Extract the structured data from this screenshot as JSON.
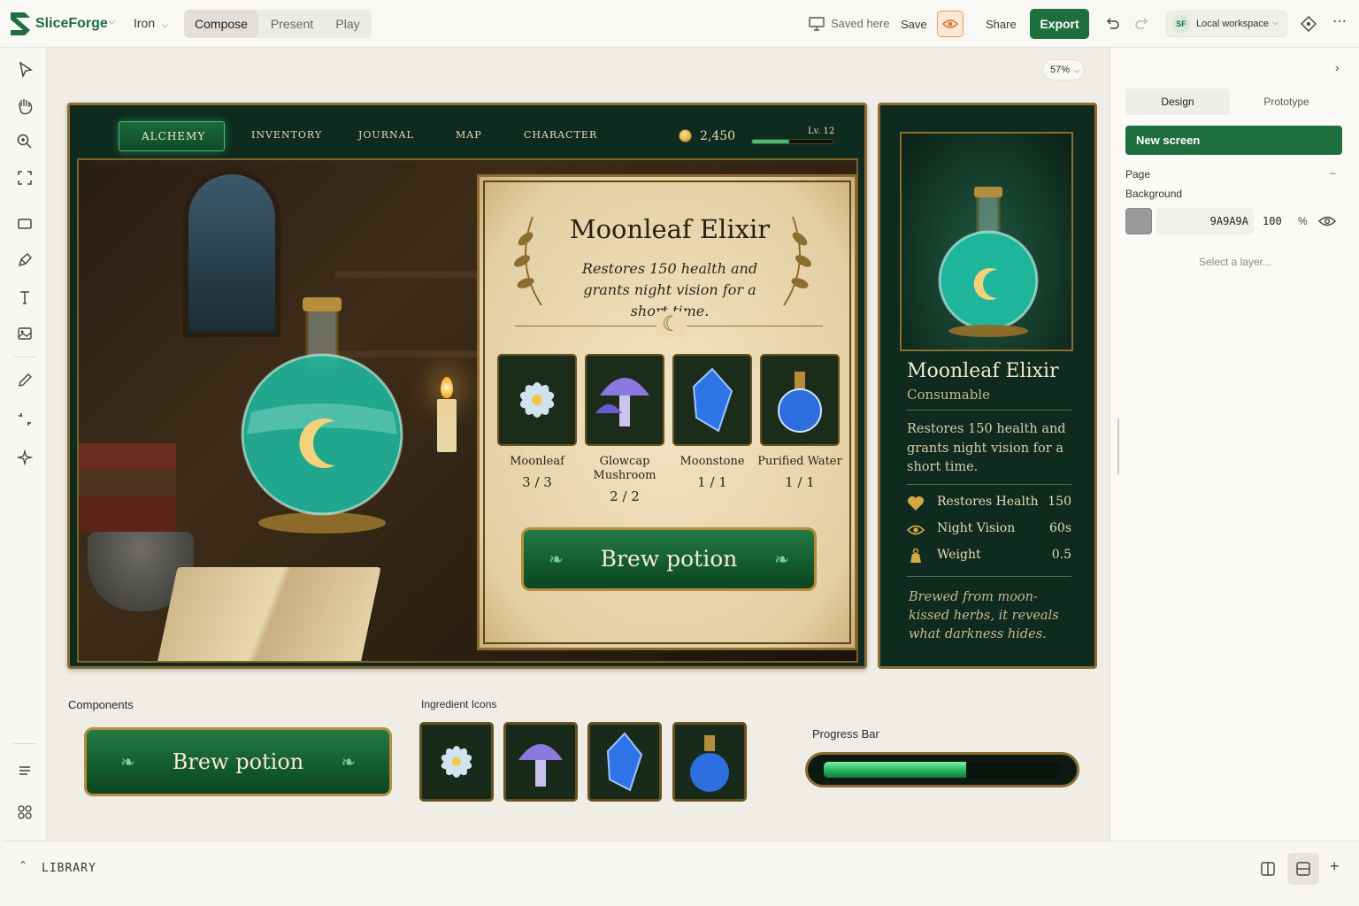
{
  "app": {
    "name": "SliceForge",
    "project": "Iron"
  },
  "topbar": {
    "modes": [
      "Compose",
      "Present",
      "Play"
    ],
    "active_mode": "Compose",
    "saved_status": "Saved here",
    "save_label": "Save",
    "share_label": "Share",
    "export_label": "Export",
    "workspace_initials": "SF",
    "workspace_label": "Local workspace"
  },
  "canvas": {
    "zoom": "57%"
  },
  "game": {
    "tabs": [
      "ALCHEMY",
      "INVENTORY",
      "JOURNAL",
      "MAP",
      "CHARACTER"
    ],
    "active_tab": "ALCHEMY",
    "gold": "2,450",
    "level": "Lv. 12",
    "recipe": {
      "title": "Moonleaf Elixir",
      "description": "Restores 150 health and grants night vision for a short time.",
      "ingredients": [
        {
          "name": "Moonleaf",
          "count": "3 / 3"
        },
        {
          "name": "Glowcap Mushroom",
          "count": "2 / 2"
        },
        {
          "name": "Moonstone",
          "count": "1 / 1"
        },
        {
          "name": "Purified Water",
          "count": "1 / 1"
        }
      ],
      "brew_label": "Brew potion"
    },
    "item_card": {
      "name": "Moonleaf Elixir",
      "type": "Consumable",
      "description": "Restores 150 health and grants night vision for a short time.",
      "stats": [
        {
          "icon": "heart-icon",
          "label": "Restores Health",
          "value": "150"
        },
        {
          "icon": "eye-icon",
          "label": "Night Vision",
          "value": "60s"
        },
        {
          "icon": "weight-icon",
          "label": "Weight",
          "value": "0.5"
        }
      ],
      "flavor": "Brewed from moon-kissed herbs, it reveals what darkness hides."
    }
  },
  "components": {
    "title": "Components",
    "brew_label": "Brew potion",
    "ingredient_icons_title": "Ingredient Icons",
    "progress_title": "Progress Bar",
    "progress_value": 0.6
  },
  "right_panel": {
    "tabs": [
      "Design",
      "Prototype"
    ],
    "active_tab": "Design",
    "new_screen_label": "New screen",
    "page_label": "Page",
    "background_label": "Background",
    "bg_hex": "9A9A9A",
    "bg_opacity": "100",
    "percent": "%",
    "empty_hint": "Select a layer..."
  },
  "bottom": {
    "library_label": "LIBRARY"
  },
  "colors": {
    "accent": "#1f6e3e",
    "game_bg": "#0f2a1e",
    "gold": "#b68d3a",
    "potion": "#2fd6b4",
    "swatch": "#9A9A9A"
  }
}
